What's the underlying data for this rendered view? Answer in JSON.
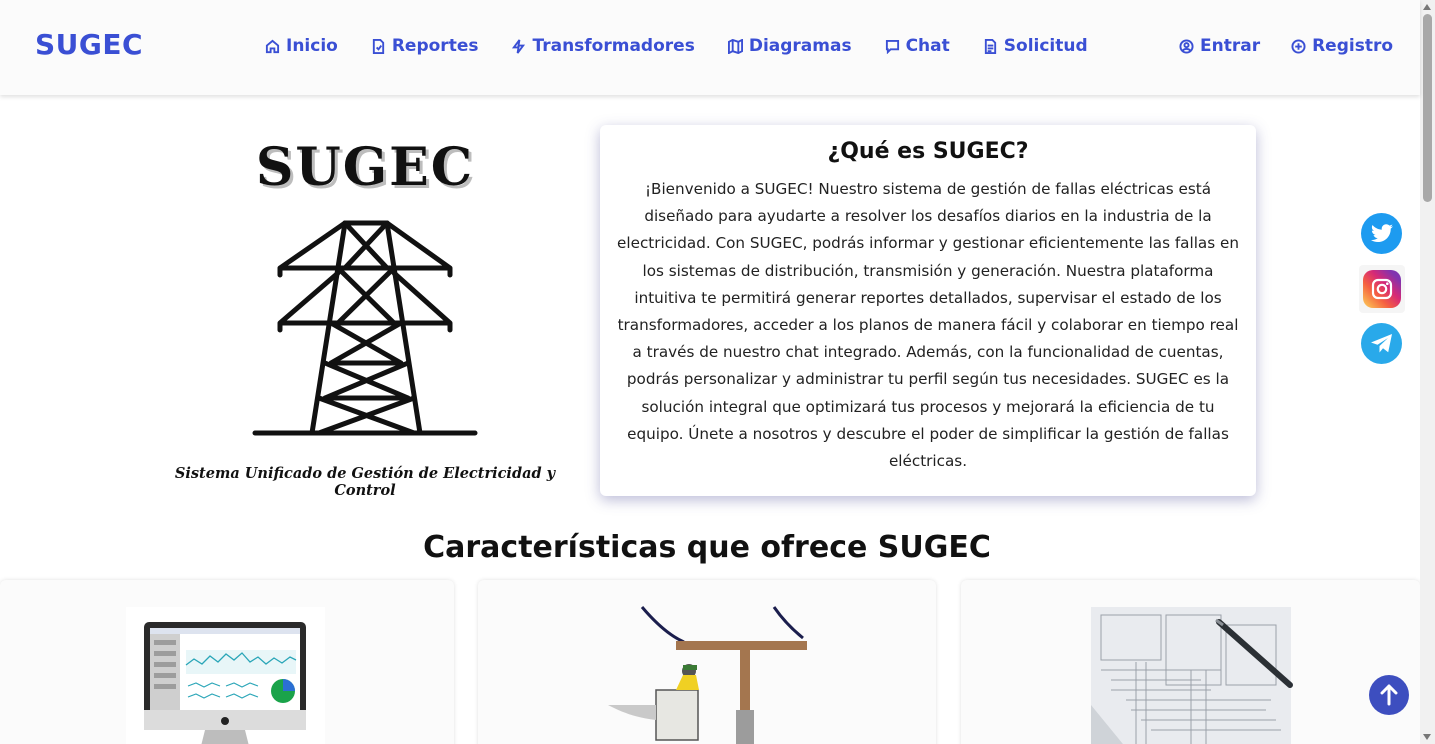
{
  "brand": "SUGEC",
  "nav": [
    {
      "label": "Inicio",
      "icon": "home-icon"
    },
    {
      "label": "Reportes",
      "icon": "report-file-icon"
    },
    {
      "label": "Transformadores",
      "icon": "lightning-icon"
    },
    {
      "label": "Diagramas",
      "icon": "map-icon"
    },
    {
      "label": "Chat",
      "icon": "chat-icon"
    },
    {
      "label": "Solicitud",
      "icon": "document-icon"
    }
  ],
  "auth": [
    {
      "label": "Entrar",
      "icon": "user-circle-icon"
    },
    {
      "label": "Registro",
      "icon": "plus-circle-icon"
    }
  ],
  "logo": {
    "title": "SUGEC",
    "subtitle": "Sistema Unificado de Gestión de Electricidad y Control"
  },
  "about": {
    "title": "¿Qué es SUGEC?",
    "text": "¡Bienvenido a SUGEC! Nuestro sistema de gestión de fallas eléctricas está diseñado para ayudarte a resolver los desafíos diarios en la industria de la electricidad. Con SUGEC, podrás informar y gestionar eficientemente las fallas en los sistemas de distribución, transmisión y generación. Nuestra plataforma intuitiva te permitirá generar reportes detallados, supervisar el estado de los transformadores, acceder a los planos de manera fácil y colaborar en tiempo real a través de nuestro chat integrado. Además, con la funcionalidad de cuentas, podrás personalizar y administrar tu perfil según tus necesidades. SUGEC es la solución integral que optimizará tus procesos y mejorará la eficiencia de tu equipo. Únete a nosotros y descubre el poder de simplificar la gestión de fallas eléctricas."
  },
  "social": [
    "twitter-icon",
    "instagram-icon",
    "telegram-icon"
  ],
  "features_heading": "Características que ofrece SUGEC",
  "colors": {
    "accent": "#3a4fd4",
    "header_bg": "#fbfbfb",
    "back_to_top": "#3d4ebf"
  }
}
